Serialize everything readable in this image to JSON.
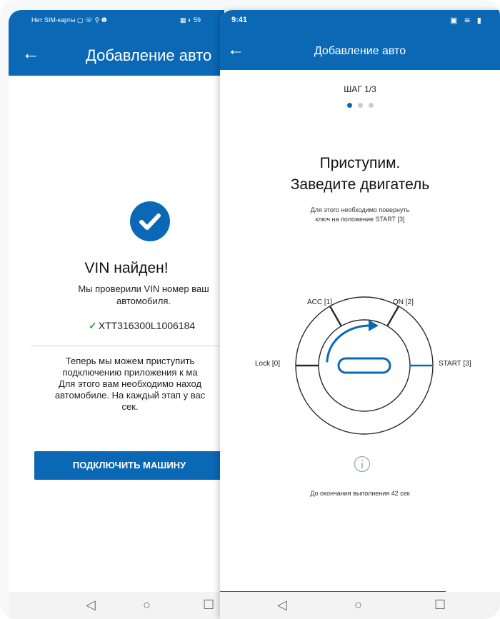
{
  "left_screen": {
    "status_left": "Нет SIM-карты ▢ ☏ ⚲ ❶",
    "status_right": "▦ ◐ 59",
    "title": "Добавление авто",
    "vin_found": "VIN найден!",
    "vin_desc_line1": "Мы проверили VIN номер ваш",
    "vin_desc_line2": "автомобиля.",
    "vin_number": "XTT316300L1006184",
    "info_line1": "Теперь мы можем приступить",
    "info_line2": "подключению приложения к ма",
    "info_line3": "Для этого вам необходимо наход",
    "info_line4": "автомобиле. На каждый этап у вас",
    "info_line5": "сек.",
    "connect_button": "ПОДКЛЮЧИТЬ МАШИНУ",
    "nav_back": "◁",
    "nav_home": "○",
    "nav_recent": "☐"
  },
  "right_screen": {
    "time": "9:41",
    "status_right": "▣ ≋ ▮",
    "title": "Добавление авто",
    "step": "ШАГ 1/3",
    "heading_line1": "Приступим.",
    "heading_line2": "Заведите двигатель",
    "note_line1": "Для этого необходимо повернуть",
    "note_line2": "ключ на положение START [3]",
    "positions": {
      "acc": "ACC [1]",
      "on": "ON [2]",
      "lock": "Lock [0]",
      "start": "START [3]"
    },
    "timer_text": "До окончания выполнения 42 сек",
    "nav_back": "◁",
    "nav_home": "○",
    "nav_recent": "☐"
  },
  "colors": {
    "primary": "#0a68b4",
    "success": "#3aa53a"
  },
  "icons": [
    "back-arrow-icon",
    "check-circle-icon",
    "check-icon",
    "info-icon",
    "ignition-key-icon",
    "rotate-arrow-icon"
  ]
}
